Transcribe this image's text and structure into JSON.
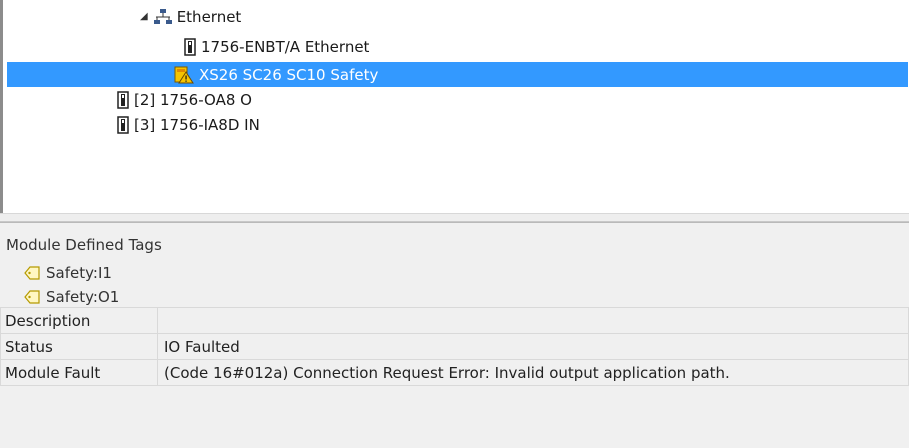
{
  "tree": {
    "ethernet_label": "Ethernet",
    "enbt_label": "1756-ENBT/A Ethernet",
    "safety_label": "XS26 SC26 SC10 Safety",
    "slot2_label": "[2] 1756-OA8 O",
    "slot3_label": "[3] 1756-IA8D IN"
  },
  "details": {
    "section_title": "Module Defined Tags",
    "tags": [
      "Safety:I1",
      "Safety:O1"
    ],
    "properties": [
      {
        "label": "Description",
        "value": ""
      },
      {
        "label": "Status",
        "value": "IO Faulted"
      },
      {
        "label": "Module Fault",
        "value": "(Code 16#012a) Connection Request Error: Invalid output application path."
      }
    ]
  },
  "colors": {
    "selection": "#3399ff",
    "panel_bg": "#f0f0f0",
    "warning": "#f5c400"
  },
  "icons": {
    "expander": "expanded-triangle-icon",
    "network": "network-icon",
    "module": "module-icon",
    "module_warning": "module-warning-icon",
    "tag": "tag-icon"
  }
}
